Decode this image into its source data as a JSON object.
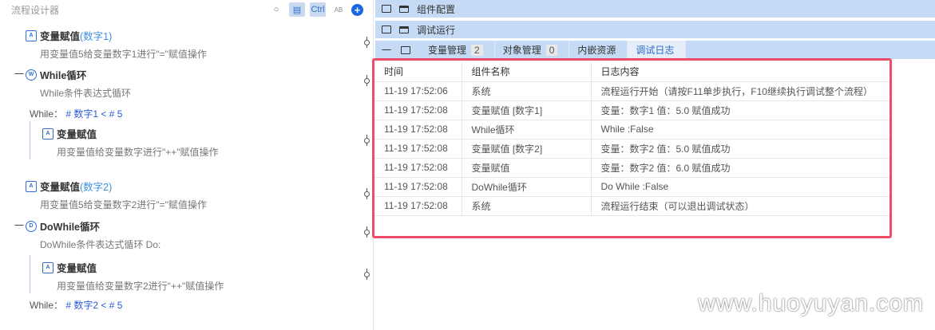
{
  "left": {
    "title": "流程设计器",
    "tools": [
      "search-icon",
      "copy-icon",
      "Ctrl",
      "AB",
      "plus-icon"
    ],
    "nodes": [
      {
        "title": "变量赋值",
        "suffix": "(数字1)",
        "desc": "用变量值5给变量数字1进行\"=\"赋值操作"
      },
      {
        "title": "While循环",
        "desc": "While条件表达式循环",
        "cond_label": "While：",
        "cond": "# 数字1 < # 5",
        "collapse": "一"
      },
      {
        "title": "变量赋值",
        "desc": "用变量值给变量数字进行\"++\"赋值操作"
      },
      {
        "title": "变量赋值",
        "suffix": "(数字2)",
        "desc": "用变量值5给变量数字2进行\"=\"赋值操作"
      },
      {
        "title": "DoWhile循环",
        "desc": "DoWhile条件表达式循环 Do:",
        "cond_label": "While：",
        "cond": "# 数字2 < # 5",
        "collapse": "一"
      },
      {
        "title": "变量赋值",
        "desc": "用变量值给变量数字2进行\"++\"赋值操作"
      }
    ]
  },
  "right": {
    "bar1": "组件配置",
    "bar2": "调试运行",
    "tab_ctl": "一",
    "tabs": [
      {
        "label": "变量管理",
        "badge": "2"
      },
      {
        "label": "对象管理",
        "badge": "0"
      },
      {
        "label": "内嵌资源"
      },
      {
        "label": "调试日志"
      }
    ],
    "log": {
      "headers": [
        "时间",
        "组件名称",
        "日志内容"
      ],
      "rows": [
        [
          "11-19 17:52:06",
          "系统",
          "流程运行开始（请按F11单步执行，F10继续执行调试整个流程）"
        ],
        [
          "11-19 17:52:08",
          "变量赋值 [数字1]",
          "变量：数字1 值：5.0 赋值成功"
        ],
        [
          "11-19 17:52:08",
          "While循环",
          "While :False"
        ],
        [
          "11-19 17:52:08",
          "变量赋值 [数字2]",
          "变量：数字2 值：5.0 赋值成功"
        ],
        [
          "11-19 17:52:08",
          "变量赋值",
          "变量：数字2 值：6.0 赋值成功"
        ],
        [
          "11-19 17:52:08",
          "DoWhile循环",
          "Do While :False"
        ],
        [
          "11-19 17:52:08",
          "系统",
          "流程运行结束（可以退出调试状态）"
        ]
      ]
    }
  },
  "watermark": "www.huoyuyan.com"
}
